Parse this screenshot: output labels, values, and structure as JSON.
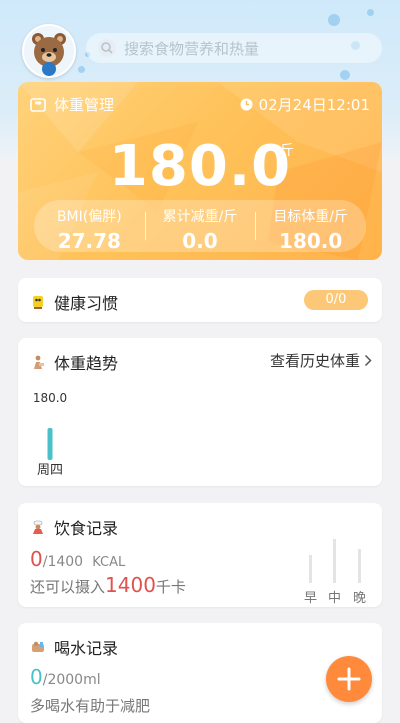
{
  "search": {
    "placeholder": "搜索食物营养和热量"
  },
  "weight": {
    "title": "体重管理",
    "time": "02月24日12:01",
    "value": "180.0",
    "unit": "斤",
    "stats": [
      {
        "label": "BMI(偏胖)",
        "value": "27.78"
      },
      {
        "label": "累计减重/斤",
        "value": "0.0"
      },
      {
        "label": "目标体重/斤",
        "value": "180.0"
      }
    ]
  },
  "habits": {
    "title": "健康习惯",
    "progress": "0/0"
  },
  "trend": {
    "title": "体重趋势",
    "link": "查看历史体重",
    "chart_data": {
      "type": "bar",
      "categories": [
        "周四"
      ],
      "values": [
        180.0
      ],
      "data_labels": [
        "180.0"
      ]
    }
  },
  "diet": {
    "title": "饮食记录",
    "eaten": "0",
    "target": "/1400",
    "unit": "KCAL",
    "remain_prefix": "还可以摄入",
    "remain_value": "1400",
    "remain_unit": "千卡",
    "meals": [
      "早",
      "中",
      "晚"
    ]
  },
  "water": {
    "title": "喝水记录",
    "drunk": "0",
    "target": "/2000ml",
    "tip": "多喝水有助于减肥"
  },
  "colors": {
    "accent": "#ff8a3c",
    "red": "#e0524f",
    "teal": "#48c2c8"
  }
}
